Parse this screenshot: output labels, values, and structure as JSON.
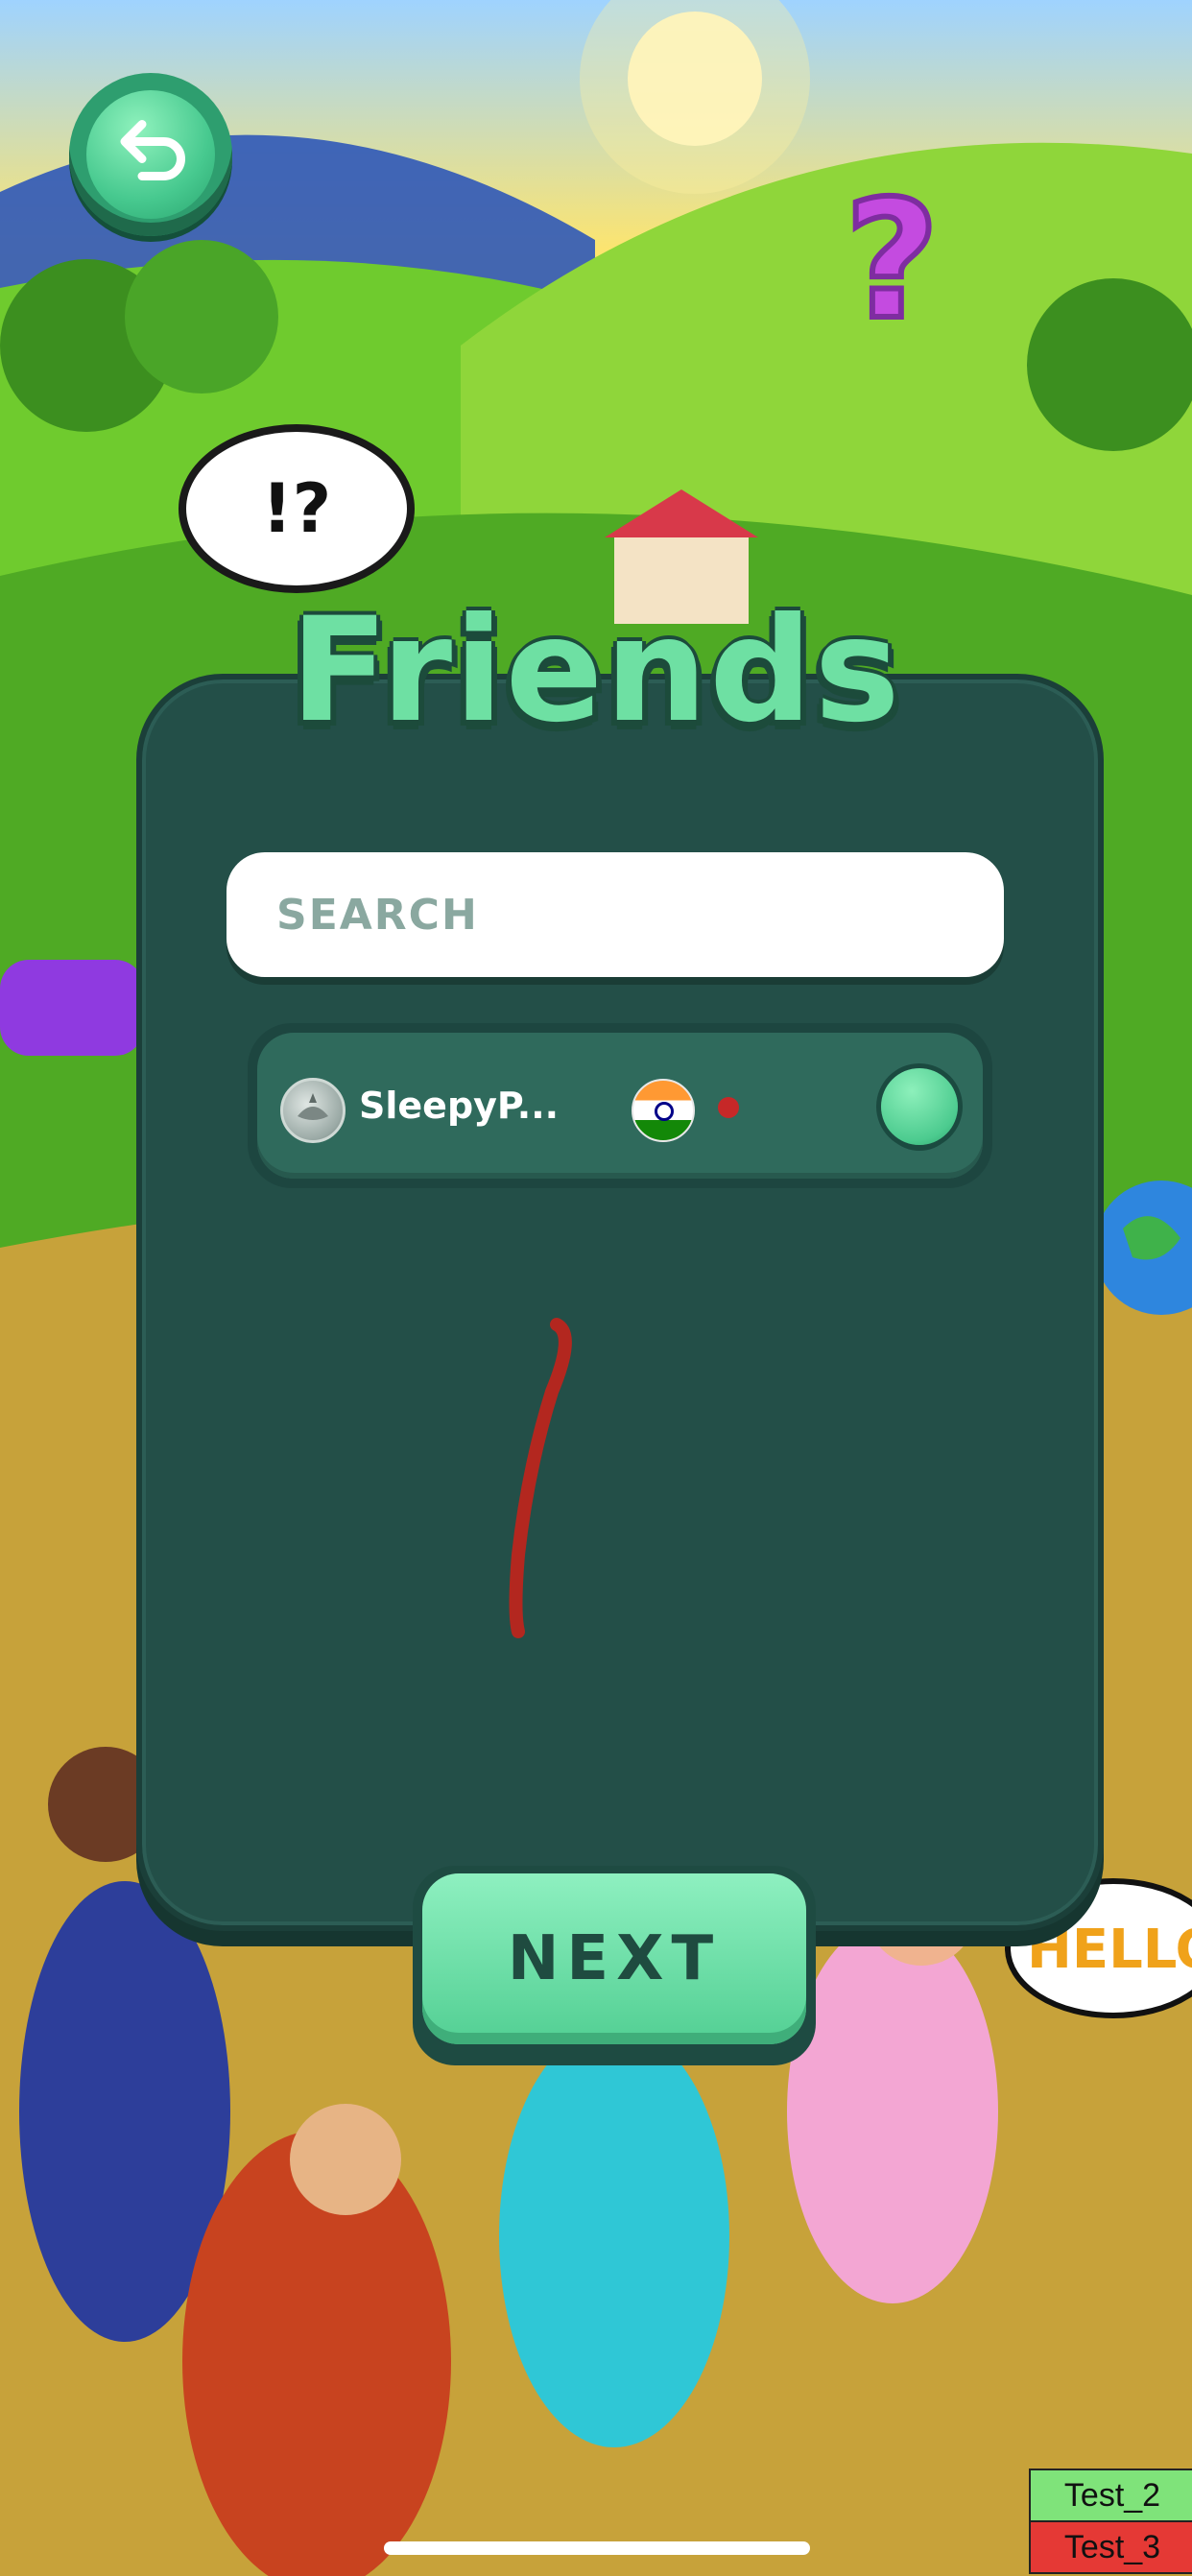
{
  "screen": {
    "title": "Friends"
  },
  "top": {
    "back_icon": "back-arrow-icon",
    "bubble_text": "!?"
  },
  "search": {
    "placeholder": "SEARCH"
  },
  "friends": [
    {
      "name": "SleepyP...",
      "country_flag": "india-flag-icon",
      "status_color": "#c62828"
    }
  ],
  "actions": {
    "next_label": "NEXT"
  },
  "debug": {
    "test2": "Test_2",
    "test3": "Test_3"
  },
  "colors": {
    "panel": "#234f48",
    "accent": "#52cf93",
    "title": "#6ee0a3"
  }
}
